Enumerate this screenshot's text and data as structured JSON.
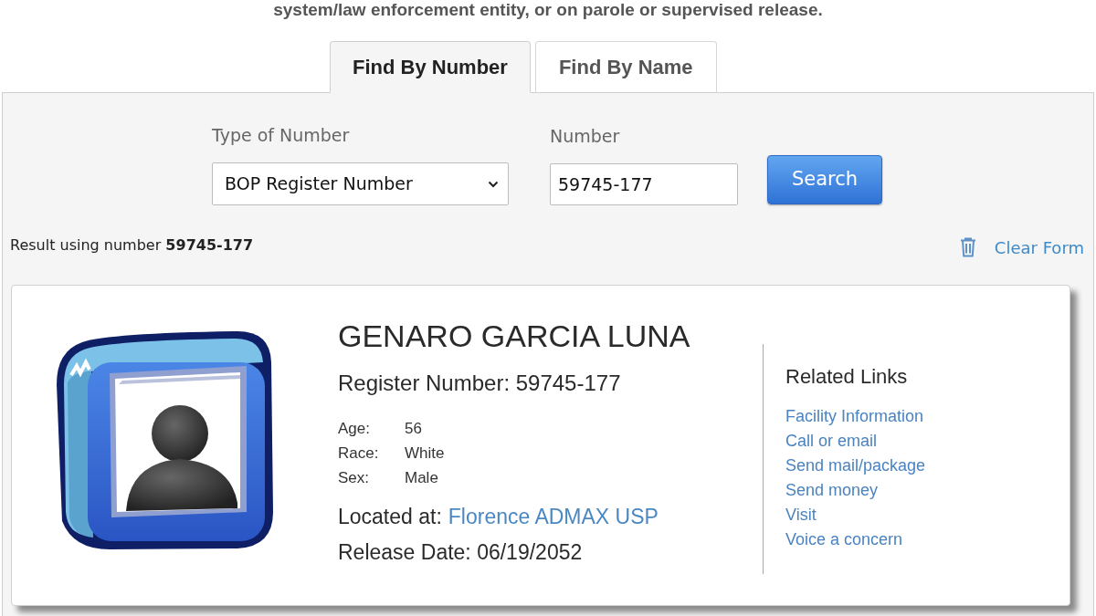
{
  "intro_text": "system/law enforcement entity, or on parole or supervised release.",
  "tabs": [
    {
      "label": "Find By Number",
      "selected": true
    },
    {
      "label": "Find By Name",
      "selected": false
    }
  ],
  "search_form": {
    "type_field": {
      "label": "Type of Number",
      "value": "BOP Register Number"
    },
    "number_field": {
      "label": "Number",
      "value": "59745-177"
    },
    "search_button": "Search"
  },
  "result_summary": "Result using number **59745-177**",
  "clear_form": "Clear Form",
  "inmate": {
    "name": "GENARO GARCIA LUNA",
    "register_number": "Register Number: 59745-177",
    "details": [
      {
        "label": "Age:",
        "value": "56"
      },
      {
        "label": "Race:",
        "value": "White"
      },
      {
        "label": "Sex:",
        "value": "Male"
      }
    ],
    "location": {
      "label": "Located at:",
      "link": "Florence ADMAX USP"
    },
    "release_date": "Release Date: 06/19/2052"
  },
  "related_links": {
    "title": "Related Links",
    "links": [
      "Facility Information",
      "Call or email",
      "Send mail/package",
      "Send money",
      "Visit",
      "Voice a concern"
    ]
  }
}
